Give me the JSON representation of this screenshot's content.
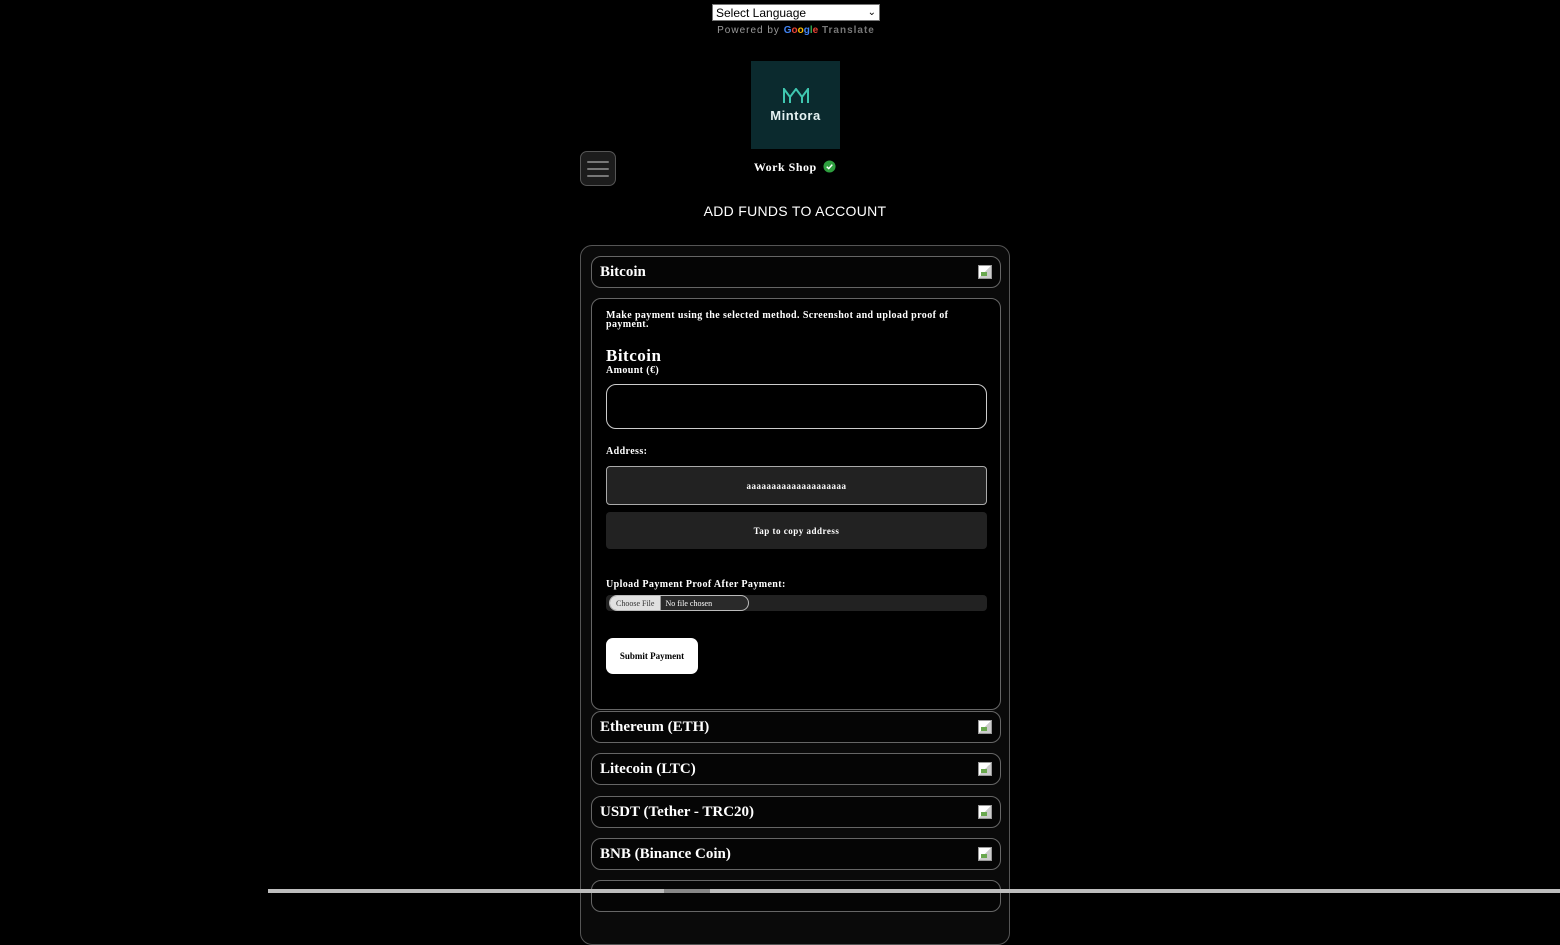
{
  "translate": {
    "select_label": "Select Language",
    "powered_by": "Powered by",
    "google": [
      "G",
      "o",
      "o",
      "g",
      "l",
      "e"
    ],
    "translate_word": "Translate"
  },
  "header": {
    "logo_text": "Mintora",
    "shop_name": "Work Shop",
    "page_title": "ADD FUNDS TO ACCOUNT"
  },
  "methods": [
    {
      "label": "Bitcoin"
    },
    {
      "label": "Ethereum (ETH)"
    },
    {
      "label": "Litecoin (LTC)"
    },
    {
      "label": "USDT (Tether - TRC20)"
    },
    {
      "label": "BNB (Binance Coin)"
    }
  ],
  "payment": {
    "instructions": "Make payment using the selected method. Screenshot and upload proof of payment.",
    "coin_title": "Bitcoin",
    "amount_label": "Amount (€)",
    "amount_value": "",
    "address_label": "Address:",
    "address_value": "aaaaaaaaaaaaaaaaaaaa",
    "copy_label": "Tap to copy address",
    "upload_label": "Upload Payment Proof After Payment:",
    "choose_file": "Choose File",
    "file_status": "No file chosen",
    "submit_label": "Submit Payment"
  },
  "colors": {
    "background": "#000000",
    "verified": "#2e9e3e",
    "logo_bg": "#0b2a2e",
    "logo_mark": "#3fc7b0"
  }
}
